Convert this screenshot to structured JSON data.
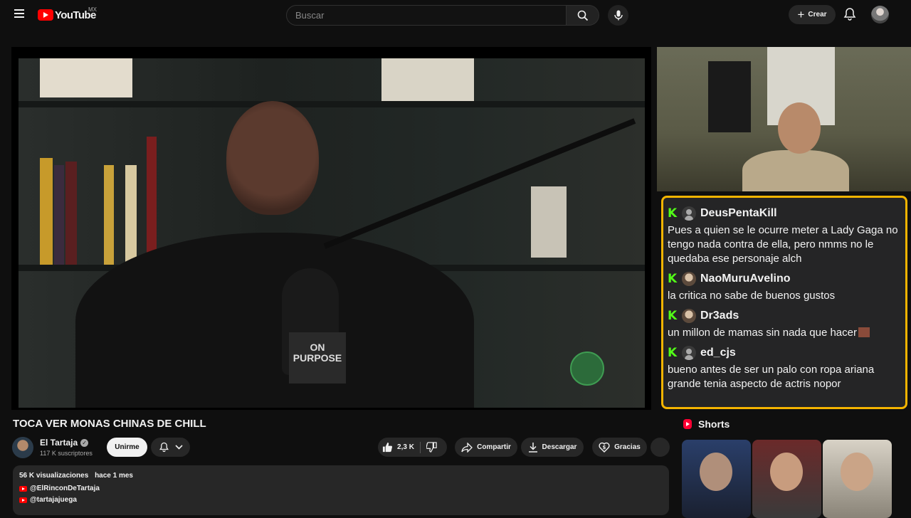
{
  "header": {
    "logo_text": "YouTube",
    "country_code": "MX",
    "search_placeholder": "Buscar",
    "create_label": "Crear"
  },
  "video": {
    "mic_flag_text": "ON PURPOSE"
  },
  "chat": {
    "messages": [
      {
        "user": "DeusPentaKill",
        "avatar": "default",
        "text": "Pues a quien se le ocurre meter a Lady Gaga no tengo nada contra de ella, pero nmms no le quedaba ese personaje alch"
      },
      {
        "user": "NaoMuruAvelino",
        "avatar": "photo",
        "text": "la critica no sabe de buenos gustos"
      },
      {
        "user": "Dr3ads",
        "avatar": "photo",
        "text": "un millon de mamas sin nada que hacer"
      },
      {
        "user": "ed_cjs",
        "avatar": "default",
        "text": "bueno antes de ser un palo con ropa ariana grande tenia aspecto de actris nopor"
      }
    ],
    "border_color": "#f4b400",
    "platform_badge_color": "#53fc18"
  },
  "info": {
    "title": "TOCA VER MONAS CHINAS DE CHILL",
    "channel_name": "El Tartaja",
    "subscribers": "117 K suscriptores",
    "join_label": "Unirme",
    "likes": "2,3 K",
    "share_label": "Compartir",
    "download_label": "Descargar",
    "thanks_label": "Gracias"
  },
  "description": {
    "views": "56 K visualizaciones",
    "date": "hace 1 mes",
    "links": [
      "@ElRinconDeTartaja",
      "@tartajajuega"
    ]
  },
  "shorts": {
    "heading": "Shorts"
  },
  "colors": {
    "accent_red": "#ff0000",
    "background": "#0f0f0f"
  }
}
